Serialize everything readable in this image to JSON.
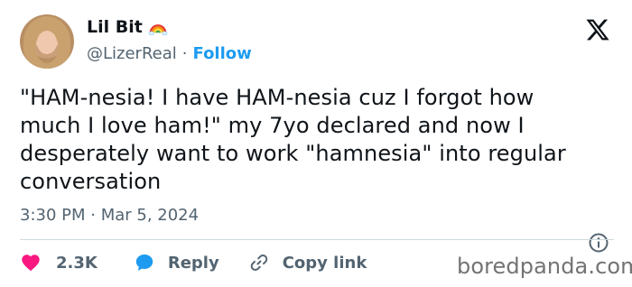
{
  "user": {
    "name": "Lil Bit",
    "handle": "@LizerReal",
    "separator": "·",
    "follow_label": "Follow",
    "emoji_icon": "rainbow-icon"
  },
  "tweet": {
    "lines": [
      "\"HAM-nesia! I have HAM-nesia cuz I forgot how",
      "much I love ham!\" my 7yo declared and now I",
      "desperately want to work \"hamnesia\" into regular",
      "conversation"
    ],
    "timestamp": "3:30 PM · Mar 5, 2024"
  },
  "actions": {
    "likes": "2.3K",
    "reply_label": "Reply",
    "copy_link_label": "Copy link"
  },
  "watermark": "boredpanda.com",
  "colors": {
    "text": "#0f1419",
    "secondary": "#536471",
    "accent_blue": "#1d9bf0",
    "like_pink": "#f91880",
    "divider": "#cfd9de"
  }
}
